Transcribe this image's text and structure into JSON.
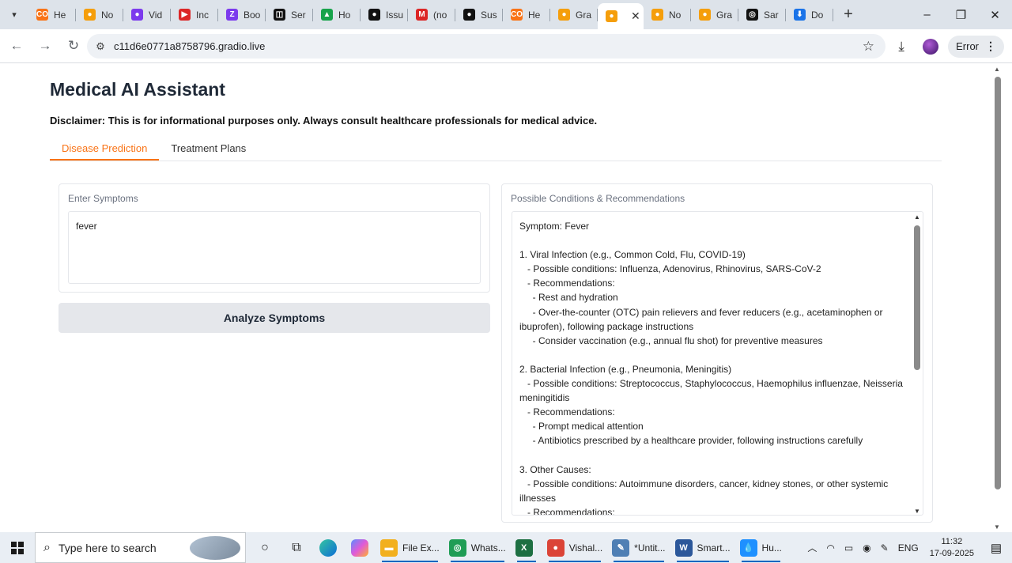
{
  "browser": {
    "tabs": [
      {
        "label": "He",
        "color": "#f97316",
        "glyph": "CO"
      },
      {
        "label": "No",
        "color": "#f59e0b",
        "glyph": "●"
      },
      {
        "label": "Vid",
        "color": "#7c3aed",
        "glyph": "●"
      },
      {
        "label": "Inc",
        "color": "#dc2626",
        "glyph": "▶"
      },
      {
        "label": "Boo",
        "color": "#7c3aed",
        "glyph": "Z"
      },
      {
        "label": "Ser",
        "color": "#111111",
        "glyph": "◫"
      },
      {
        "label": "Ho",
        "color": "#16a34a",
        "glyph": "▲"
      },
      {
        "label": "Issu",
        "color": "#111111",
        "glyph": "●"
      },
      {
        "label": "(no",
        "color": "#dc2626",
        "glyph": "M"
      },
      {
        "label": "Sus",
        "color": "#111111",
        "glyph": "●"
      },
      {
        "label": "He",
        "color": "#f97316",
        "glyph": "CO"
      },
      {
        "label": "Gra",
        "color": "#f59e0b",
        "glyph": "●"
      },
      {
        "label": "",
        "color": "#f59e0b",
        "glyph": "●",
        "active": true
      },
      {
        "label": "No",
        "color": "#f59e0b",
        "glyph": "●"
      },
      {
        "label": "Gra",
        "color": "#f59e0b",
        "glyph": "●"
      },
      {
        "label": "Sar",
        "color": "#111111",
        "glyph": "◎"
      },
      {
        "label": "Do",
        "color": "#1a73e8",
        "glyph": "⬇"
      }
    ],
    "url": "c11d6e0771a8758796.gradio.live",
    "error_label": "Error"
  },
  "app": {
    "title": "Medical AI Assistant",
    "disclaimer": "Disclaimer: This is for informational purposes only. Always consult healthcare professionals for medical advice.",
    "tabs": [
      "Disease Prediction",
      "Treatment Plans"
    ],
    "symptoms_label": "Enter Symptoms",
    "symptoms_value": "fever",
    "analyze_button": "Analyze Symptoms",
    "output_label": "Possible Conditions & Recommendations",
    "output_text": "Symptom: Fever\n\n1. Viral Infection (e.g., Common Cold, Flu, COVID-19)\n   - Possible conditions: Influenza, Adenovirus, Rhinovirus, SARS-CoV-2\n   - Recommendations:\n     - Rest and hydration\n     - Over-the-counter (OTC) pain relievers and fever reducers (e.g., acetaminophen or ibuprofen), following package instructions\n     - Consider vaccination (e.g., annual flu shot) for preventive measures\n\n2. Bacterial Infection (e.g., Pneumonia, Meningitis)\n   - Possible conditions: Streptococcus, Staphylococcus, Haemophilus influenzae, Neisseria meningitidis\n   - Recommendations:\n     - Prompt medical attention\n     - Antibiotics prescribed by a healthcare provider, following instructions carefully\n\n3. Other Causes:\n   - Possible conditions: Autoimmune disorders, cancer, kidney stones, or other systemic illnesses\n   - Recommendations:"
  },
  "taskbar": {
    "search_placeholder": "Type here to search",
    "apps": [
      {
        "label": "File Ex...",
        "color": "#f2b01e",
        "glyph": "▬"
      },
      {
        "label": "Whats...",
        "color": "#1f9d55",
        "glyph": "◎"
      },
      {
        "label": "",
        "color": "#1d6f42",
        "glyph": "X"
      },
      {
        "label": "Vishal...",
        "color": "#db4437",
        "glyph": "●"
      },
      {
        "label": "*Untit...",
        "color": "#4f7fb4",
        "glyph": "✎"
      },
      {
        "label": "Smart...",
        "color": "#2b579a",
        "glyph": "W"
      },
      {
        "label": "Hu...",
        "color": "#1e90ff",
        "glyph": "💧"
      }
    ],
    "language": "ENG",
    "time": "11:32",
    "date": "17-09-2025"
  }
}
